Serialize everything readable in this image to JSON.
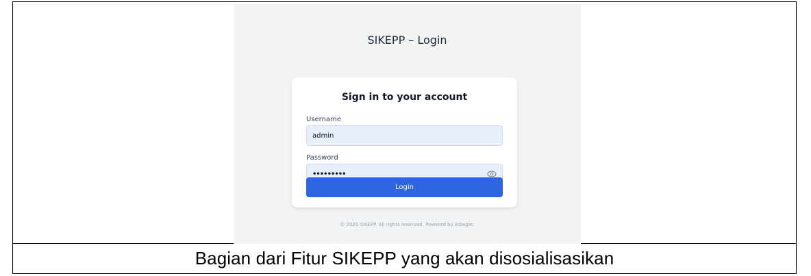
{
  "app": {
    "title": "SIKEPP – Login"
  },
  "login_card": {
    "heading": "Sign in to your account",
    "username_label": "Username",
    "username_value": "admin",
    "password_label": "Password",
    "password_value": "•••••••••",
    "show_password_icon": "eye-icon",
    "login_button_label": "Login"
  },
  "footer": {
    "text": "© 2025 SIKEPP. All rights reserved. Powered by Esteget."
  },
  "document": {
    "caption": "Bagian dari Fitur SIKEPP yang akan disosialisasikan"
  },
  "colors": {
    "primary_button": "#2f66e0",
    "input_background": "#e8eefc",
    "page_background": "#f1f3f5"
  }
}
